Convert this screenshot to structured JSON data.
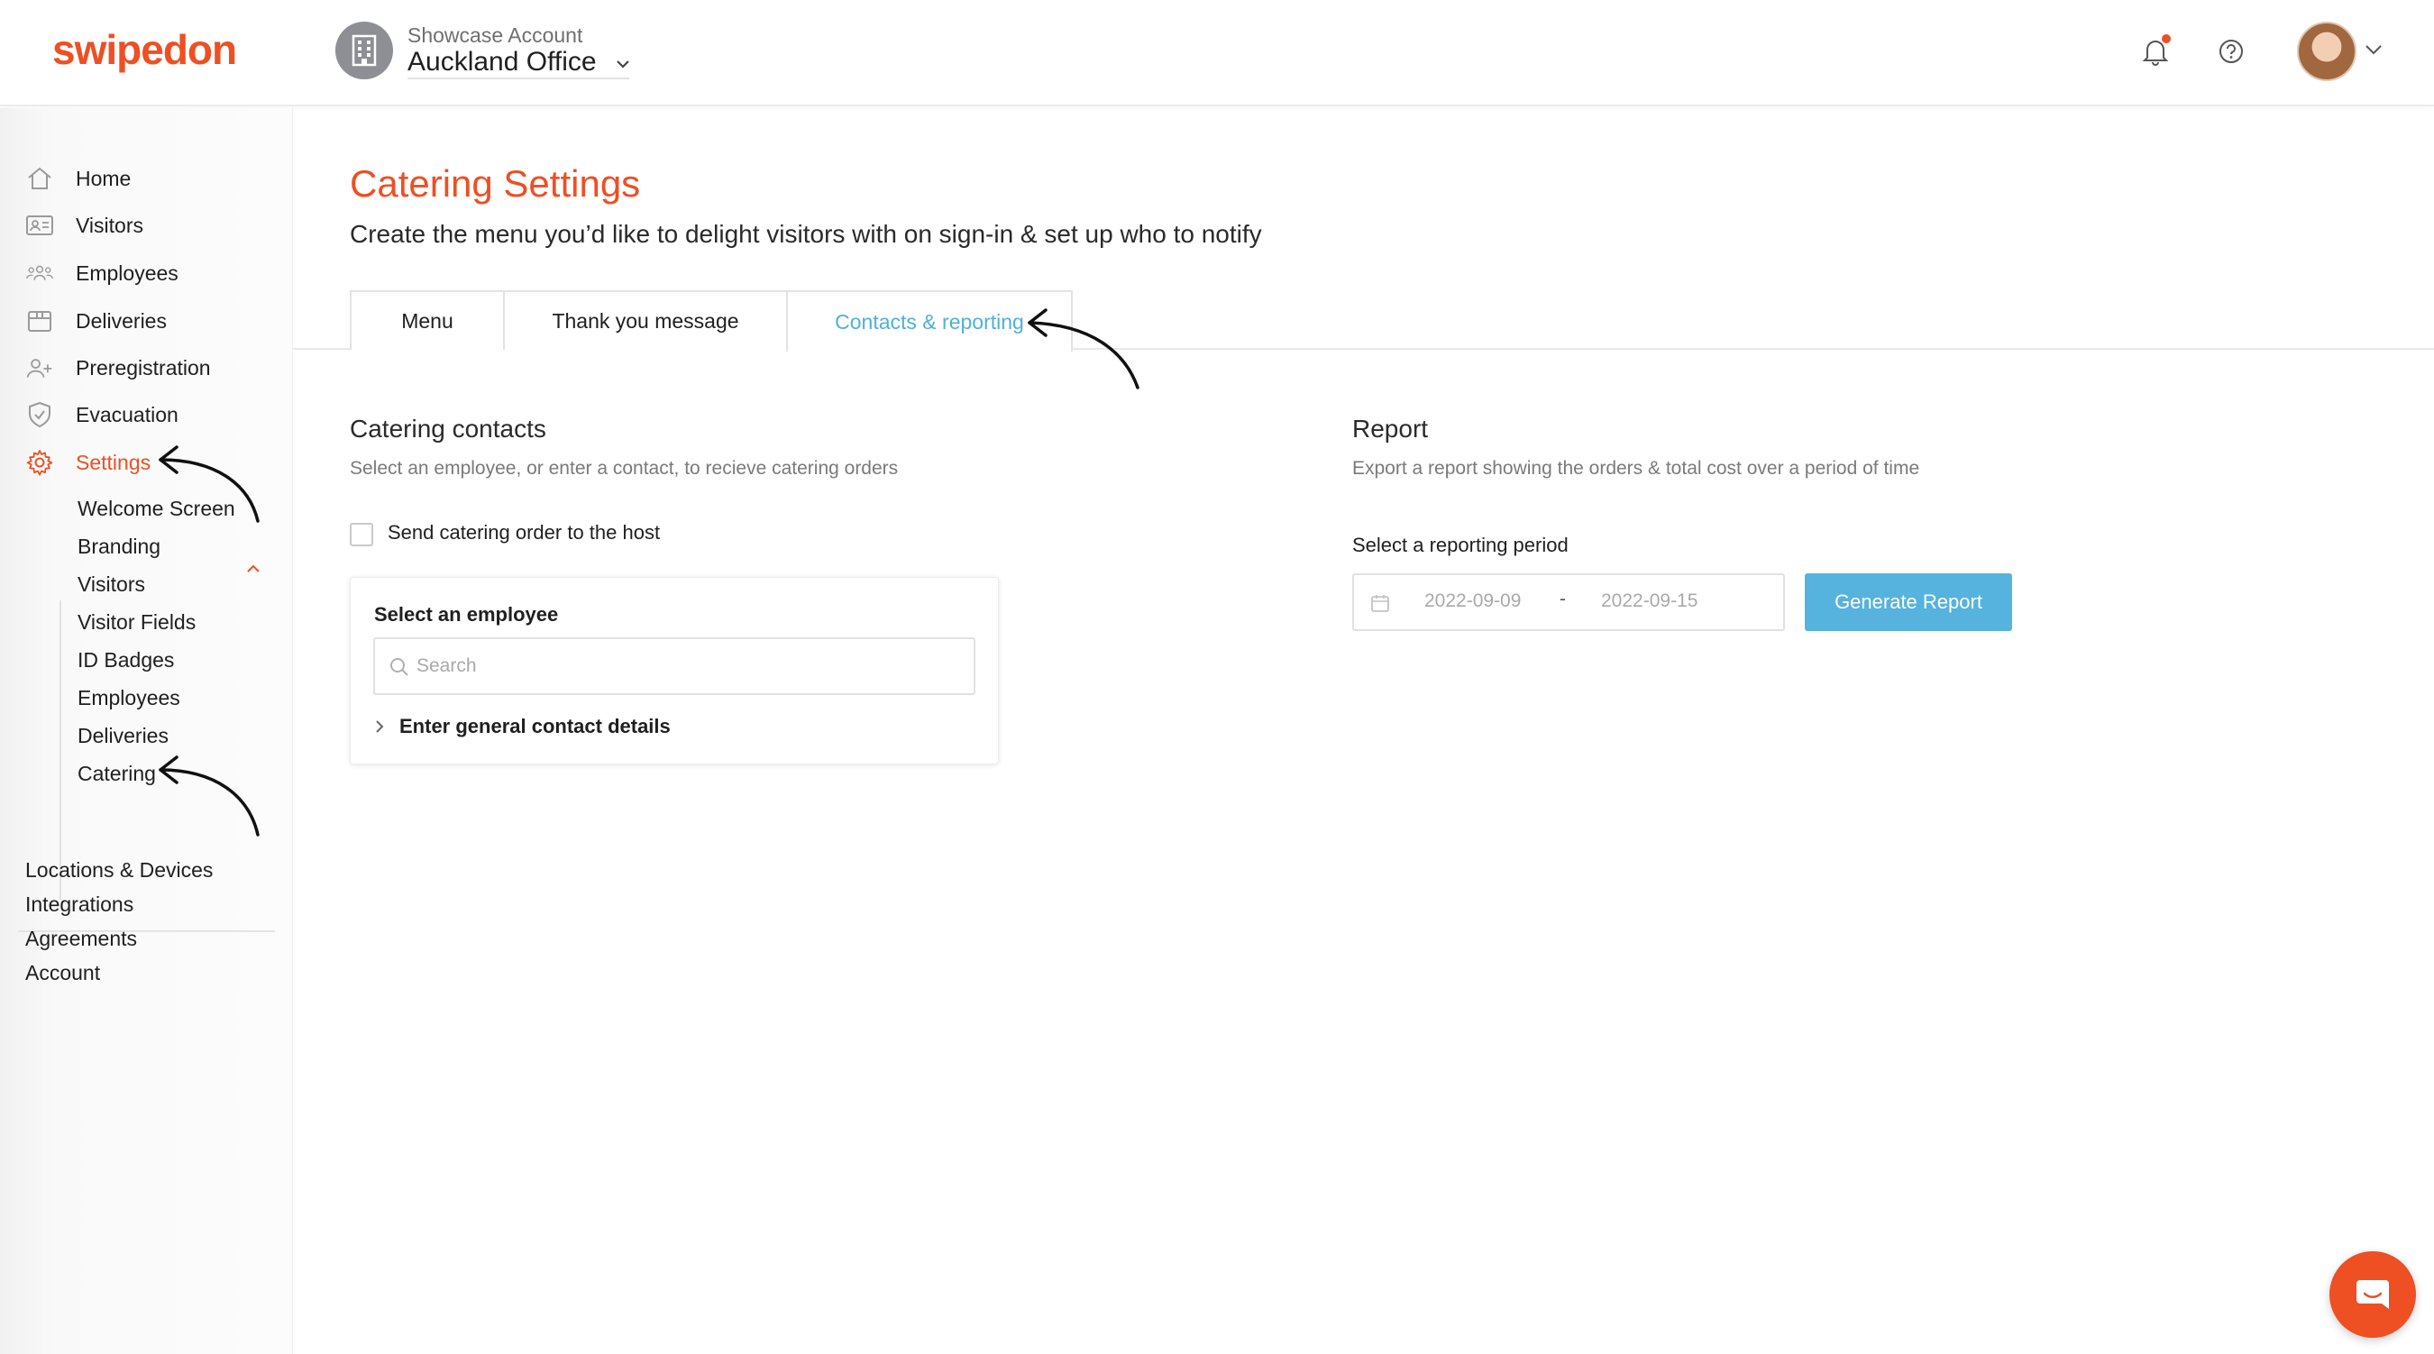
{
  "brand": {
    "logo_text": "swipedon",
    "accent": "#ee4f23",
    "link": "#4fb0d9",
    "button": "#55b3dd"
  },
  "account": {
    "label": "Showcase Account",
    "location": "Auckland Office"
  },
  "header": {
    "icons": [
      "bell-icon",
      "help-icon",
      "avatar",
      "chevron-down-icon"
    ]
  },
  "sidebar": {
    "items": [
      {
        "label": "Home",
        "icon": "home-icon"
      },
      {
        "label": "Visitors",
        "icon": "id-card-icon"
      },
      {
        "label": "Employees",
        "icon": "people-icon"
      },
      {
        "label": "Deliveries",
        "icon": "box-icon"
      },
      {
        "label": "Preregistration",
        "icon": "user-plus-icon"
      },
      {
        "label": "Evacuation",
        "icon": "shield-icon"
      },
      {
        "label": "Settings",
        "icon": "gear-icon",
        "active": true
      }
    ],
    "settings_sub": [
      "Welcome Screen",
      "Branding",
      "Visitors",
      "Visitor Fields",
      "ID Badges",
      "Employees",
      "Deliveries",
      "Catering"
    ],
    "footer": [
      "Locations & Devices",
      "Integrations",
      "Agreements",
      "Account"
    ]
  },
  "page": {
    "title": "Catering Settings",
    "subtitle": "Create the menu you’d like to delight visitors with on sign-in & set up who to notify"
  },
  "tabs": [
    {
      "label": "Menu",
      "active": false
    },
    {
      "label": "Thank you message",
      "active": false
    },
    {
      "label": "Contacts & reporting",
      "active": true
    }
  ],
  "contacts": {
    "title": "Catering contacts",
    "description": "Select an employee, or enter a contact, to recieve catering orders",
    "checkbox_label": "Send catering order to the host",
    "checkbox_checked": false,
    "select_title": "Select an employee",
    "search_placeholder": "Search",
    "general_contact": "Enter general contact details"
  },
  "report": {
    "title": "Report",
    "description": "Export a report showing the orders & total cost over a period of time",
    "period_label": "Select a reporting period",
    "start_date": "2022-09-09",
    "separator": "-",
    "end_date": "2022-09-15",
    "button_label": "Generate Report"
  }
}
